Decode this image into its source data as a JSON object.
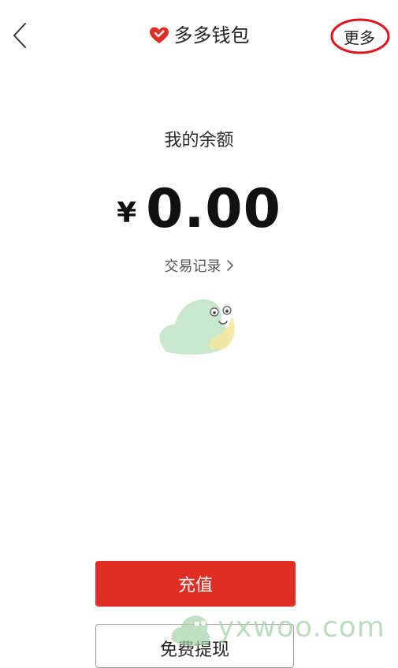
{
  "header": {
    "title": "多多钱包",
    "more_label": "更多"
  },
  "balance": {
    "label": "我的余额",
    "currency": "¥",
    "amount": "0.00",
    "transactions_link": "交易记录"
  },
  "actions": {
    "recharge_label": "充值",
    "withdraw_label": "免费提现"
  },
  "watermark": {
    "text": "yxwoo.com"
  },
  "colors": {
    "brand_red": "#e02e24",
    "highlight_circle": "#e0141e",
    "watermark_green": "#a5d2aa"
  },
  "icons": {
    "back": "chevron-left-icon",
    "title": "heart-icon",
    "link": "chevron-right-icon"
  }
}
